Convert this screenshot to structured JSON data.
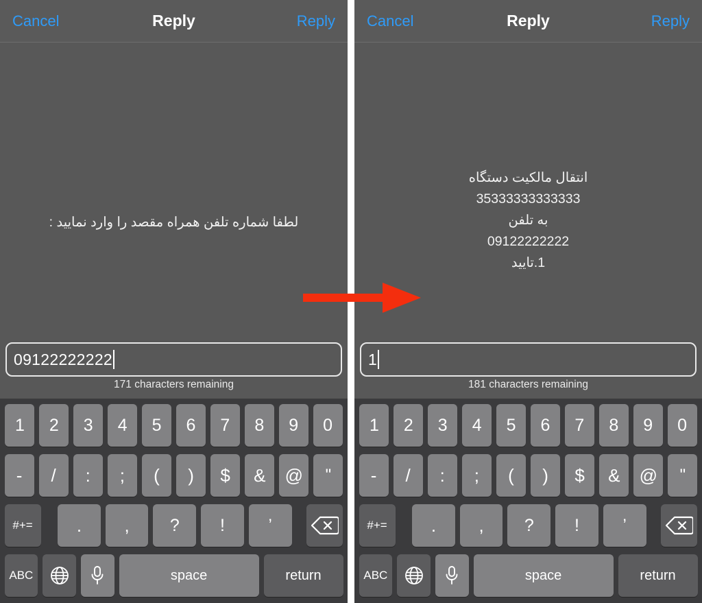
{
  "colors": {
    "background": "#585858",
    "navbar": "#5a5a5a",
    "accent_link": "#2f9bf8",
    "keyboard_bg": "#3b3b3d",
    "key": "#828284",
    "key_dark": "#5c5c5e",
    "text": "#ffffff",
    "divider": "#ffffff",
    "annotation_arrow": "#f42e0e"
  },
  "navbar": {
    "cancel_label": "Cancel",
    "title": "Reply",
    "send_label": "Reply"
  },
  "panels": [
    {
      "id": "left-panel",
      "message_lines": [
        "لطفا شماره تلفن همراه مقصد را وارد نمایید :"
      ],
      "input": {
        "value": "09122222222",
        "placeholder": "",
        "counter": "171 characters remaining"
      }
    },
    {
      "id": "right-panel",
      "message_lines": [
        "انتقال مالکیت دستگاه",
        "35333333333333",
        "به تلفن",
        "09122222222",
        "1.تایید"
      ],
      "input": {
        "value": "1",
        "placeholder": "",
        "counter": "181 characters remaining"
      }
    }
  ],
  "keyboard": {
    "row1": [
      "1",
      "2",
      "3",
      "4",
      "5",
      "6",
      "7",
      "8",
      "9",
      "0"
    ],
    "row2": [
      "-",
      "/",
      ":",
      ";",
      "(",
      ")",
      "$",
      "&",
      "@",
      "\""
    ],
    "row3": {
      "symbol_switch": "#+=",
      "keys": [
        ".",
        ",",
        "?",
        "!",
        "’"
      ],
      "delete_icon": "backspace-icon"
    },
    "row4": {
      "abc_label": "ABC",
      "globe_icon": "globe-icon",
      "mic_icon": "microphone-icon",
      "space_label": "space",
      "return_label": "return"
    }
  },
  "annotation": {
    "arrow_icon": "right-arrow-annotation",
    "color": "#f42e0e"
  }
}
